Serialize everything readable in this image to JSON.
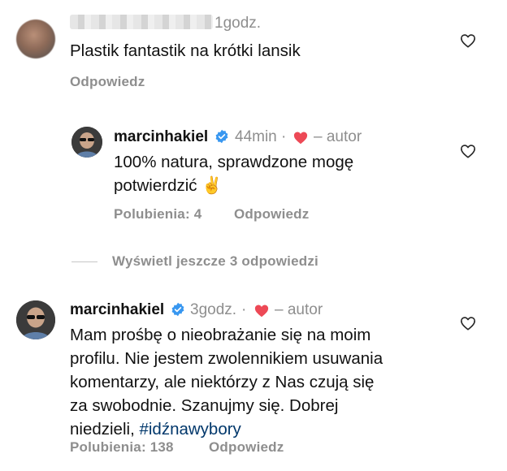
{
  "comments": [
    {
      "meta_time": "1godz.",
      "text": "Plastik fantastik na krótki lansik",
      "reply_label": "Odpowiedz",
      "avatar": "blurred-avatar"
    },
    {
      "username": "marcinhakiel",
      "meta_time": "44min",
      "author_label": "– autor",
      "text_line1": "100% natura, sprawdzone mogę",
      "text_line2": "potwierdzić ✌️",
      "likes_label": "Polubienia: 4",
      "reply_label": "Odpowiedz",
      "avatar": "profile-photo"
    },
    {
      "username": "marcinhakiel",
      "meta_time": "3godz.",
      "author_label": "– autor",
      "text_lines": [
        "Mam prośbę o nieobrażanie się na moim",
        "profilu. Nie jestem zwolennikiem usuwania",
        "komentarzy, ale niektórzy z Nas czują się",
        "za swobodnie. Szanujmy się. Dobrej"
      ],
      "text_last_prefix": "niedzieli, ",
      "hashtag": "#idźnawybory",
      "likes_label": "Polubienia: 138",
      "reply_label": "Odpowiedz",
      "avatar": "profile-photo"
    }
  ],
  "view_more_replies": "Wyświetl jeszcze 3 odpowiedzi",
  "icons": {
    "like": "heart-outline-icon",
    "verified": "verified-badge-icon",
    "creator_liked": "red-heart-icon"
  },
  "colors": {
    "text": "#111111",
    "secondary": "#8e8e8e",
    "verified": "#3897f0",
    "heart": "#ed4956",
    "hashtag": "#00376b"
  }
}
